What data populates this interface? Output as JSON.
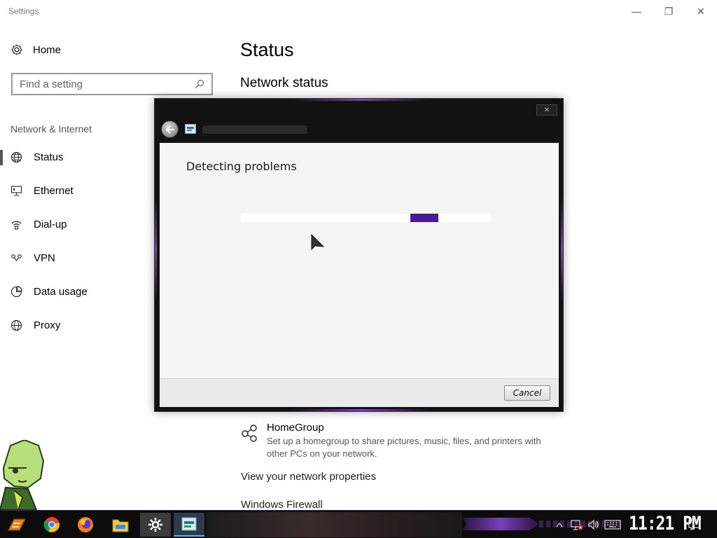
{
  "window": {
    "title": "Settings",
    "minimize": "—",
    "maximize": "❐",
    "close": "✕"
  },
  "sidebar": {
    "home_label": "Home",
    "search_placeholder": "Find a setting",
    "section_label": "Network & Internet",
    "items": [
      {
        "label": "Status",
        "icon": "globe-icon",
        "active": true
      },
      {
        "label": "Ethernet",
        "icon": "ethernet-icon"
      },
      {
        "label": "Dial-up",
        "icon": "dialup-icon"
      },
      {
        "label": "VPN",
        "icon": "vpn-icon"
      },
      {
        "label": "Data usage",
        "icon": "data-usage-icon"
      },
      {
        "label": "Proxy",
        "icon": "proxy-globe-icon"
      }
    ]
  },
  "main": {
    "title": "Status",
    "section": "Network status",
    "homegroup": {
      "title": "HomeGroup",
      "description": "Set up a homegroup to share pictures, music, files, and printers with other PCs on your network."
    },
    "links": [
      "View your network properties",
      "Windows Firewall"
    ]
  },
  "dialog": {
    "close": "✕",
    "heading": "Detecting problems",
    "progress_chunk_start": 0.68,
    "cancel_label": "Cancel"
  },
  "taskbar": {
    "apps": [
      "start-icon",
      "chrome-icon",
      "firefox-icon",
      "file-explorer-icon",
      "settings-icon",
      "troubleshooter-icon"
    ],
    "clock": "11:21 PM",
    "accent": "#7b3fb8"
  }
}
